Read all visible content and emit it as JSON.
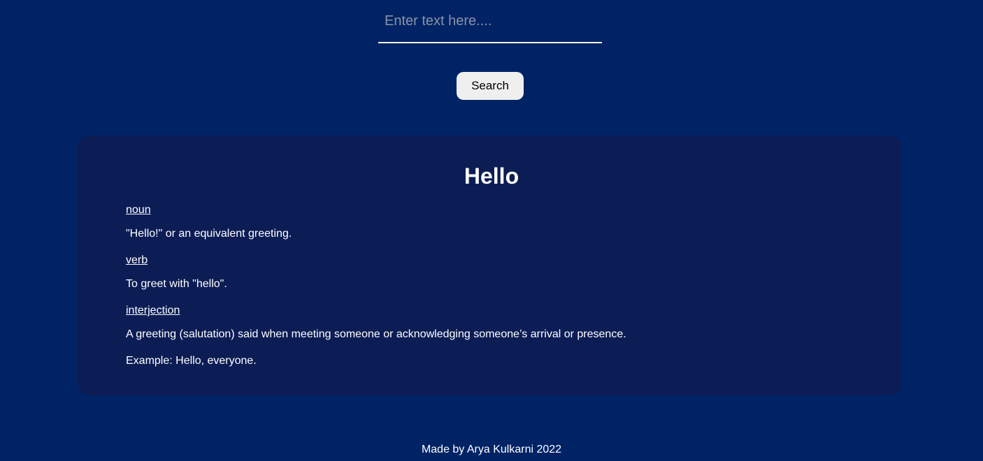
{
  "search": {
    "placeholder": "Enter text here....",
    "value": "",
    "button_label": "Search"
  },
  "result": {
    "word": "Hello",
    "meanings": [
      {
        "part_of_speech": "noun",
        "definition": "\"Hello!\" or an equivalent greeting."
      },
      {
        "part_of_speech": "verb",
        "definition": "To greet with \"hello\"."
      },
      {
        "part_of_speech": "interjection",
        "definition": "A greeting (salutation) said when meeting someone or acknowledging someone’s arrival or presence."
      }
    ],
    "example": "Example: Hello, everyone."
  },
  "footer": {
    "text": "Made by Arya Kulkarni 2022"
  },
  "colors": {
    "background": "#002366",
    "card": "#0c1d55",
    "button": "#efefef"
  }
}
